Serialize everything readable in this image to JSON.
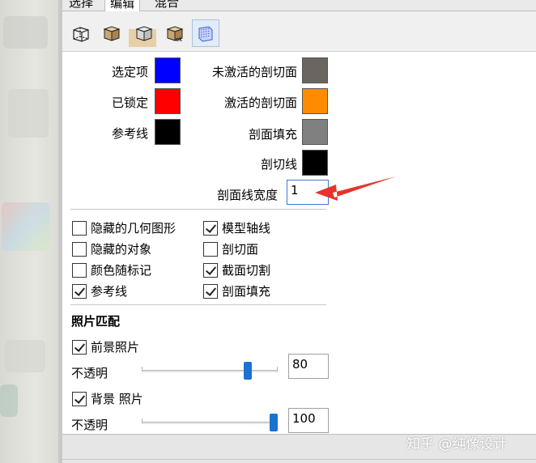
{
  "tabs": [
    {
      "label": "选择"
    },
    {
      "label": "编辑"
    },
    {
      "label": "混合"
    }
  ],
  "toolbar": {
    "icons": [
      "wireframe-box-icon",
      "shaded-box-icon",
      "textured-box-icon",
      "box-ok-icon",
      "section-plane-icon"
    ]
  },
  "colors_left": [
    {
      "label": "选定项",
      "color": "#0000ff"
    },
    {
      "label": "已锁定",
      "color": "#ff0000"
    },
    {
      "label": "参考线",
      "color": "#000000"
    }
  ],
  "colors_right": [
    {
      "label": "未激活的剖切面",
      "color": "#6b655f"
    },
    {
      "label": "激活的剖切面",
      "color": "#ff8c00"
    },
    {
      "label": "剖面填充",
      "color": "#808080"
    },
    {
      "label": "剖切线",
      "color": "#000000"
    }
  ],
  "section_line_width": {
    "label": "剖面线宽度",
    "value": "1"
  },
  "checkboxes_left": [
    {
      "label": "隐藏的几何图形",
      "checked": false
    },
    {
      "label": "隐藏的对象",
      "checked": false
    },
    {
      "label": "颜色随标记",
      "checked": false
    },
    {
      "label": "参考线",
      "checked": true
    }
  ],
  "checkboxes_right": [
    {
      "label": "模型轴线",
      "checked": true
    },
    {
      "label": "剖切面",
      "checked": false
    },
    {
      "label": "截面切割",
      "checked": true
    },
    {
      "label": "剖面填充",
      "checked": true
    }
  ],
  "photo_match": {
    "title": "照片匹配",
    "foreground": {
      "label": "前景照片",
      "checked": true,
      "opacity_label": "不透明",
      "opacity": 80
    },
    "background": {
      "label": "背景 照片",
      "checked": true,
      "opacity_label": "不透明",
      "opacity": 100
    }
  },
  "annotation": {
    "arrow_color": "#e8322b"
  },
  "watermark": "知乎 @纯像设计"
}
